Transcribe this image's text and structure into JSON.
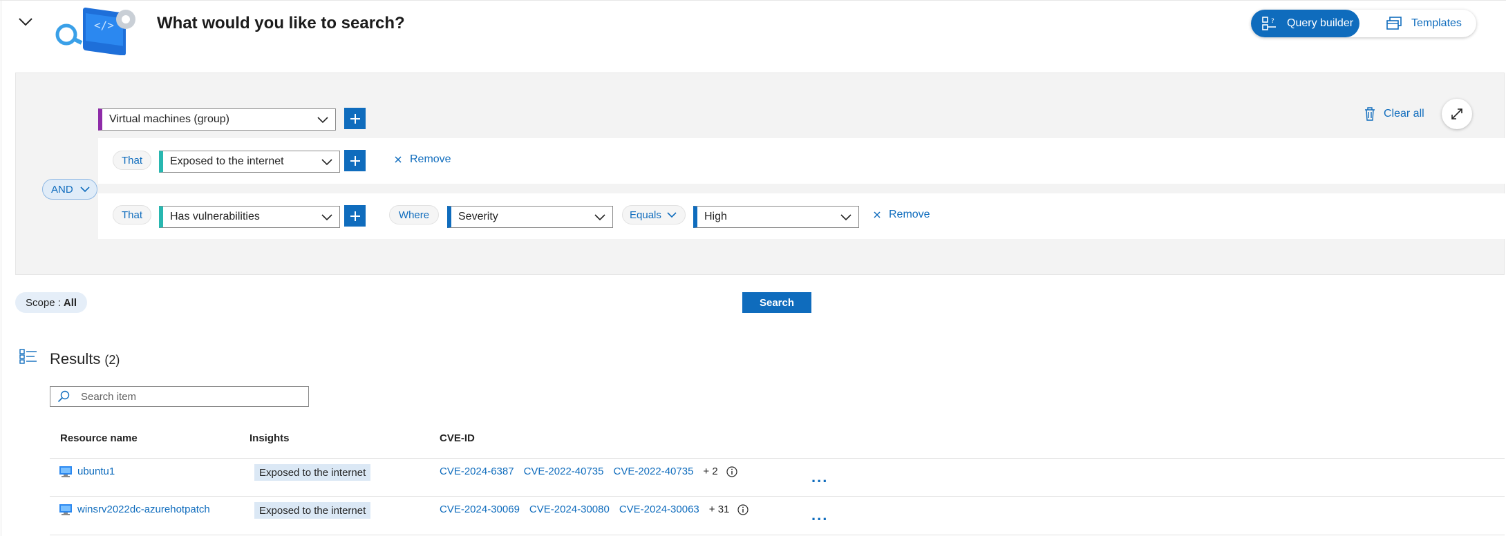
{
  "header": {
    "title": "What would you like to search?",
    "mode_toggle": {
      "query_builder_label": "Query builder",
      "templates_label": "Templates"
    }
  },
  "builder": {
    "root_select": "Virtual machines (group)",
    "clear_all_label": "Clear all",
    "operator": "AND",
    "conditions": [
      {
        "connector": "That",
        "select": "Exposed to the internet",
        "remove_label": "Remove"
      },
      {
        "connector": "That",
        "select": "Has vulnerabilities",
        "where_label": "Where",
        "field_select": "Severity",
        "operator_select": "Equals",
        "value_select": "High",
        "remove_label": "Remove"
      }
    ]
  },
  "scope": {
    "label": "Scope :",
    "value": "All"
  },
  "search_button": "Search",
  "results": {
    "title": "Results",
    "count": "(2)",
    "search_placeholder": "Search item",
    "columns": [
      "Resource name",
      "Insights",
      "CVE-ID"
    ],
    "rows": [
      {
        "name": "ubuntu1",
        "insight": "Exposed to the internet",
        "cves": [
          "CVE-2024-6387",
          "CVE-2022-40735",
          "CVE-2022-40735"
        ],
        "more": "+ 2"
      },
      {
        "name": "winsrv2022dc-azurehotpatch",
        "insight": "Exposed to the internet",
        "cves": [
          "CVE-2024-30069",
          "CVE-2024-30080",
          "CVE-2024-30063"
        ],
        "more": "+ 31"
      }
    ],
    "row_menu": "..."
  },
  "colors": {
    "accent": "#0f6cbd",
    "group_marker": "#8e2ba8",
    "condition_marker": "#28b7b0"
  }
}
